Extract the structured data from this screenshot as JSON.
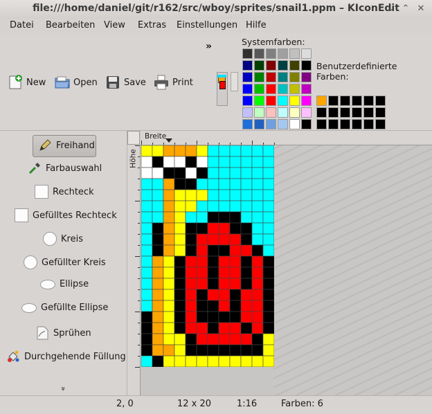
{
  "window": {
    "title": "file:///home/daniel/git/r162/src/wboy/sprites/snail1.ppm – KIconEdit",
    "buttons": [
      "⌄",
      "⌃",
      "✕"
    ]
  },
  "menu": [
    "Datei",
    "Bearbeiten",
    "View",
    "Extras",
    "Einstellungen",
    "Hilfe"
  ],
  "toolbar": {
    "new_label": "New",
    "open_label": "Open",
    "save_label": "Save",
    "print_label": "Print",
    "overflow": "»"
  },
  "palette": {
    "system_label": "Systemfarben:",
    "custom_label": "Benutzerdefinierte Farben:",
    "system_colors": [
      [
        "#303030",
        "#585858",
        "#808080",
        "#a0a0a0",
        "#c0c0c0",
        "#dcdcdc"
      ],
      [
        "#000080",
        "#004000",
        "#800000",
        "#004040",
        "#404000",
        "#000000"
      ],
      [
        "#0000c0",
        "#008000",
        "#c00000",
        "#008080",
        "#808000",
        "#800080"
      ],
      [
        "#0000ff",
        "#00c000",
        "#ff0000",
        "#00c0c0",
        "#c0c000",
        "#c000c0"
      ],
      [
        "#0000ff",
        "#00ff00",
        "#ff0000",
        "#00ffff",
        "#ffff00",
        "#ff00ff"
      ],
      [
        "#c0c0ff",
        "#c0ffc0",
        "#ffc0c0",
        "#c0ffff",
        "#ffffc0",
        "#ffc0ff"
      ],
      [
        "#1e6fd9",
        "#2060c0",
        "#6ea0e0",
        "#a6c8f0",
        "#ffffff",
        "#000000"
      ]
    ],
    "custom_colors": [
      [
        "#ffa500",
        "#000000",
        "#000000",
        "#000000",
        "#000000",
        "#000000"
      ],
      [
        "#000000",
        "#000000",
        "#000000",
        "#000000",
        "#000000",
        "#000000"
      ],
      [
        "#000000",
        "#000000",
        "#000000",
        "#000000",
        "#000000",
        "#000000"
      ]
    ]
  },
  "tools": [
    {
      "label": "Freihand",
      "icon": "pencil-icon",
      "active": true
    },
    {
      "label": "Farbauswahl",
      "icon": "eyedropper-icon"
    },
    {
      "label": "Rechteck",
      "icon": "rectangle-icon"
    },
    {
      "label": "Gefülltes Rechteck",
      "icon": "filled-rectangle-icon"
    },
    {
      "label": "Kreis",
      "icon": "circle-icon"
    },
    {
      "label": "Gefüllter Kreis",
      "icon": "filled-circle-icon"
    },
    {
      "label": "Ellipse",
      "icon": "ellipse-icon"
    },
    {
      "label": "Gefüllte Ellipse",
      "icon": "filled-ellipse-icon"
    },
    {
      "label": "Sprühen",
      "icon": "spray-icon"
    },
    {
      "label": "Durchgehende Füllung",
      "icon": "fill-icon"
    }
  ],
  "tools_more": "»",
  "ruler": {
    "width_label": "Breite",
    "height_label": "Höhe"
  },
  "image": {
    "cols": 12,
    "rows": 20,
    "palette": {
      "W": "#ffffff",
      "Y": "#ffff00",
      "O": "#ffa500",
      "C": "#00ffff",
      "K": "#000000",
      "R": "#ff0000"
    },
    "pixels": [
      "YYOOOYCCCCCC",
      "WKWWKWCCCCCC",
      "WWKKWKCCCCCC",
      "CCOKKCCCCCCC",
      "CCOYYYCCCCCC",
      "CCOYYCCCCCCC",
      "CCOYCCKKKCCC",
      "CKOYKKRRKKCC",
      "CKOYKRRRRKCC",
      "CKOYKRKKRRKC",
      "COYKRRKRRKRK",
      "COYKRRKRRKRK",
      "COYKRRKRRKRK",
      "COYKRKRRKRRK",
      "COYKRKKRKRRK",
      "KOYKRKKKKRRK",
      "KOYKRRKRRKRK",
      "KOYYKRRRRRKY",
      "KOOYKKKKKKKY",
      "CKYYYYYYYYYY"
    ]
  },
  "status": {
    "position": "2, 0",
    "size": "12 x 20",
    "zoom": "1:16",
    "colors": "Farben: 6"
  }
}
